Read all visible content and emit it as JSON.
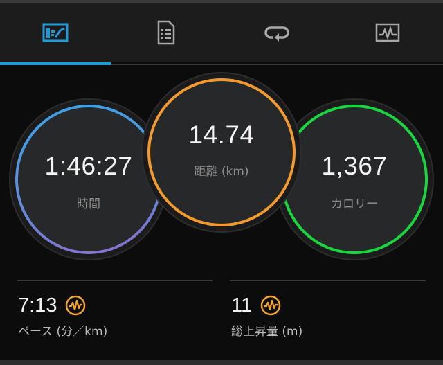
{
  "tabs": [
    {
      "icon": "stats-chart-icon",
      "active": true
    },
    {
      "icon": "document-list-icon",
      "active": false
    },
    {
      "icon": "loop-arrow-icon",
      "active": false
    },
    {
      "icon": "pulse-graph-icon",
      "active": false
    }
  ],
  "colors": {
    "accent": "#1e9bd8",
    "time_ring_start": "#3aa3e6",
    "time_ring_end": "#8a6fc8",
    "distance_ring": "#f29a2e",
    "calories_ring": "#19d640",
    "badge": "#f2a531"
  },
  "summary": {
    "time": {
      "value": "1:46:27",
      "label": "時間"
    },
    "distance": {
      "value": "14.74",
      "label": "距離 (km)"
    },
    "calories": {
      "value": "1,367",
      "label": "カロリー"
    }
  },
  "stats": {
    "pace": {
      "value": "7:13",
      "label": "ペース (分／km)",
      "icon": "heart-pulse-badge-icon"
    },
    "elevation": {
      "value": "11",
      "label": "総上昇量 (m)",
      "icon": "heart-pulse-badge-icon"
    }
  }
}
